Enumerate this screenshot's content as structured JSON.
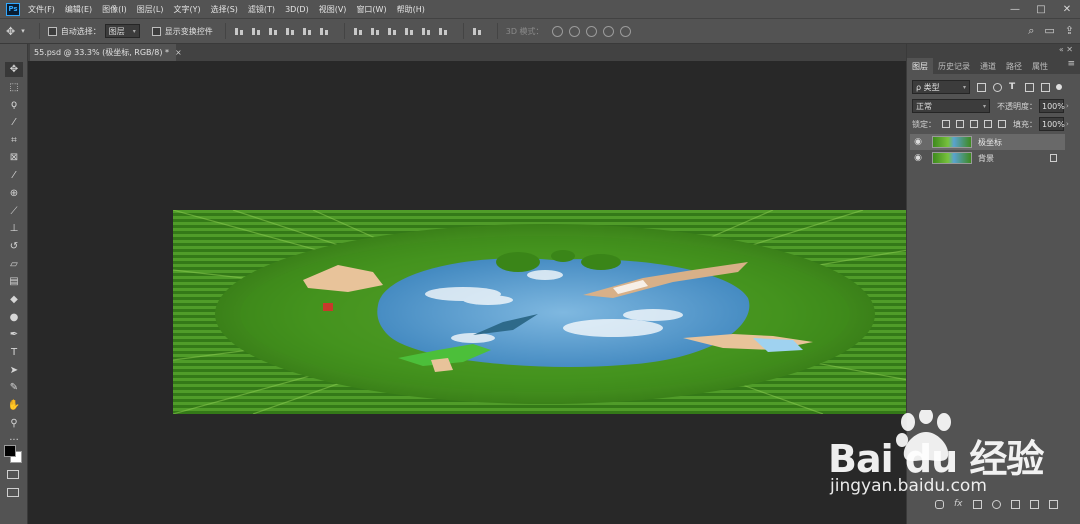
{
  "app": {
    "logo_text": "Ps"
  },
  "menu": [
    "文件(F)",
    "编辑(E)",
    "图像(I)",
    "图层(L)",
    "文字(Y)",
    "选择(S)",
    "滤镜(T)",
    "3D(D)",
    "视图(V)",
    "窗口(W)",
    "帮助(H)"
  ],
  "window_controls": {
    "minimize": "—",
    "maximize": "□",
    "close": "✕"
  },
  "options_bar": {
    "auto_select_label": "自动选择：",
    "auto_select_value": "图层",
    "show_transform_label": "显示变换控件",
    "mode_3d_label": "3D 模式："
  },
  "document": {
    "tab_title": "55.psd @ 33.3% (极坐标, RGB/8) *",
    "close": "×"
  },
  "panels": {
    "tabs": [
      "图层",
      "历史记录",
      "通道",
      "路径",
      "属性"
    ],
    "active_tab": "图层",
    "filter_label": "ρ 类型",
    "blend_mode": "正常",
    "opacity_label": "不透明度：",
    "opacity_value": "100%",
    "lock_label": "锁定：",
    "fill_label": "填充：",
    "fill_value": "100%",
    "layers": [
      {
        "name": "极坐标",
        "selected": true,
        "locked": false
      },
      {
        "name": "背景",
        "selected": false,
        "locked": true
      }
    ]
  },
  "watermark": {
    "brand": "Bai du 经验",
    "url": "jingyan.baidu.com"
  }
}
